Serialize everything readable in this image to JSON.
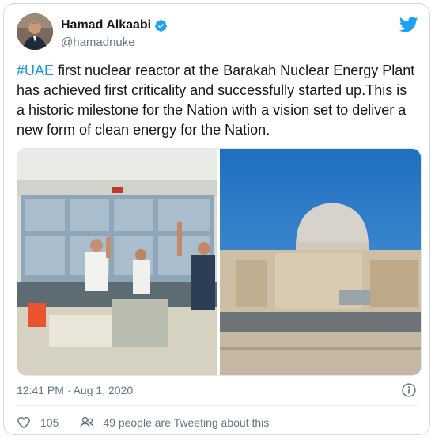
{
  "author": {
    "name": "Hamad Alkaabi",
    "handle": "@hamadnuke",
    "verified": true
  },
  "tweet": {
    "hashtag": "#UAE",
    "text": " first nuclear reactor at the Barakah Nuclear Energy Plant has achieved first criticality and successfully started up.This is a historic milestone for the Nation with a vision set to deliver a new form of clean energy for the Nation."
  },
  "meta": {
    "timestamp": "12:41 PM · Aug 1, 2020"
  },
  "engagement": {
    "likes": "105",
    "people_tweeting": "49 people are Tweeting about this"
  },
  "colors": {
    "accent": "#1da1f2",
    "link": "#1b95e0",
    "muted": "#657786"
  },
  "icons": {
    "brand": "twitter-bird-icon",
    "verified": "verified-badge-icon",
    "info": "info-icon",
    "like": "heart-icon",
    "people": "people-icon"
  }
}
